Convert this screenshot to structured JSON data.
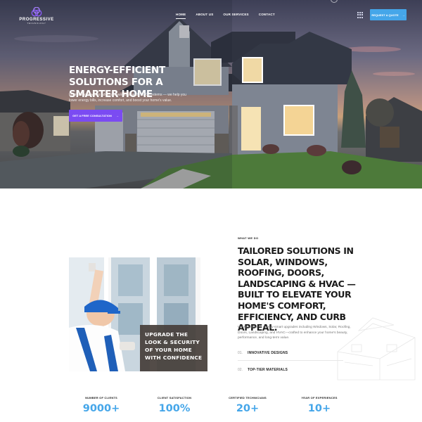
{
  "brand": {
    "name": "PROGRESSIVE",
    "tagline": "TECHNOLOGY"
  },
  "nav": {
    "items": [
      "HOME",
      "ABOUT US",
      "OUR SERVICES",
      "CONTACT"
    ],
    "active": "HOME"
  },
  "header": {
    "quote_button": "REQUEST A QUOTE",
    "quote_arrow": "→"
  },
  "hero": {
    "title": "ENERGY-EFFICIENT SOLUTIONS FOR A SMARTER HOME",
    "description": "From solar power to advanced windows and HVAC systems — we help you lower energy bills, increase comfort, and boost your home's value.",
    "cta_label": "GET A FREE CONSULTATION",
    "cta_arrow": "→"
  },
  "what_we_do": {
    "eyebrow": "WHAT WE DO",
    "title": "TAILORED SOLUTIONS IN SOLAR, WINDOWS, ROOFING, DOORS, LANDSCAPING & HVAC —BUILT TO ELEVATE YOUR HOME'S COMFORT, EFFICIENCY, AND CURB APPEAL.",
    "description": "We specialize in energy-smart upgrades including Windows, Solar, Roofing, Doors, Landscaping, and HVAC—crafted to enhance your home's beauty, performance, and long-term value.",
    "features": [
      {
        "num": "01.",
        "label": "INNOVATIVE DESIGNS"
      },
      {
        "num": "02.",
        "label": "TOP-TIER MATERIALS"
      }
    ],
    "image_caption": "UPGRADE THE LOOK & SECURITY OF YOUR HOME WITH CONFIDENCE"
  },
  "stats": [
    {
      "label": "NUMBER OF CLIENTS",
      "value": "9000+"
    },
    {
      "label": "CLIENT SATISFACTION",
      "value": "100%"
    },
    {
      "label": "CERTIFIED TECHNICIANS",
      "value": "20+"
    },
    {
      "label": "YEAR OF EXPERIENCES",
      "value": "10+"
    }
  ],
  "colors": {
    "accent_blue": "#45a6e9",
    "accent_purple": "#7b4bf2",
    "brand_mark": "#8a5cf5"
  }
}
